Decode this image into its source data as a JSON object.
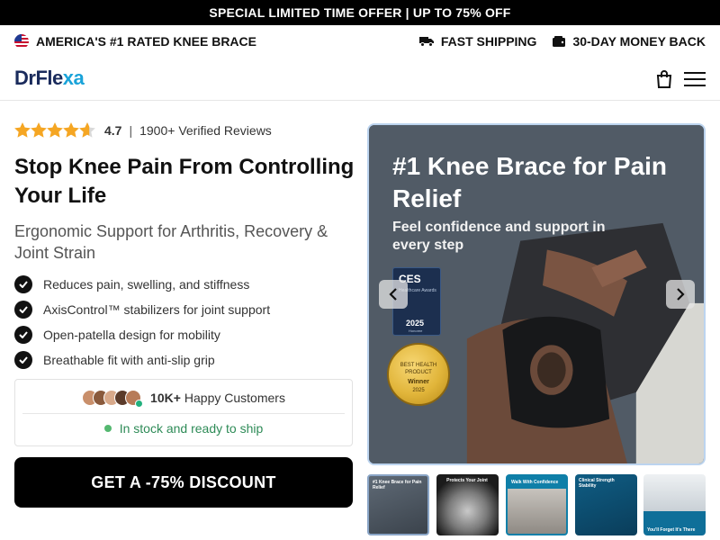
{
  "promo_bar": {
    "text": "SPECIAL LIMITED TIME OFFER | UP TO 75% OFF"
  },
  "trust_bar": {
    "left": {
      "icon": "us-flag-icon",
      "text": "AMERICA'S #1 RATED KNEE BRACE"
    },
    "right": [
      {
        "icon": "truck-icon",
        "text": "FAST SHIPPING"
      },
      {
        "icon": "wallet-icon",
        "text": "30-DAY MONEY BACK"
      }
    ]
  },
  "header": {
    "logo_main": "DrFle",
    "logo_accent": "xa",
    "cart_icon": "shopping-bag-icon",
    "menu_icon": "hamburger-menu-icon"
  },
  "product": {
    "rating_value": "4.7",
    "rating_separator": "|",
    "reviews_text": "1900+ Verified Reviews",
    "stars": 4.7,
    "title": "Stop Knee Pain From Controlling Your Life",
    "subtitle": "Ergonomic Support for Arthritis, Recovery & Joint Strain",
    "benefits": [
      "Reduces pain, swelling, and stiffness",
      "AxisControl™ stabilizers for joint support",
      "Open-patella design for mobility",
      "Breathable fit with anti-slip grip"
    ],
    "social_count": "10K+",
    "social_text": "Happy Customers",
    "stock_text": "In stock and ready to ship",
    "cta_label": "GET A -75% DISCOUNT"
  },
  "gallery": {
    "hero_heading": "#1 Knee Brace for Pain Relief",
    "hero_sub": "Feel confidence and support in every step",
    "ces_badge": {
      "logo": "CES",
      "text": "Healthcare Awards",
      "year": "2025",
      "note": "Honoree"
    },
    "medal": {
      "line1": "BEST HEALTH",
      "line2": "PRODUCT",
      "line3": "Winner",
      "line4": "2025"
    },
    "prev_icon": "chevron-left-icon",
    "next_icon": "chevron-right-icon",
    "thumbnails": [
      {
        "caption": "#1 Knee Brace for Pain Relief",
        "active": true
      },
      {
        "caption": "Protects Your Joint",
        "active": false
      },
      {
        "caption": "Walk With Confidence",
        "active": false
      },
      {
        "caption": "Clinical Strength Stability",
        "active": false
      },
      {
        "caption": "You'll Forget It's There",
        "active": false
      }
    ]
  },
  "colors": {
    "accent_blue": "#1aa3d9",
    "logo_navy": "#1a2b5c",
    "star": "#f5a623",
    "stock_green": "#2e8b57",
    "cta_bg": "#000000"
  }
}
